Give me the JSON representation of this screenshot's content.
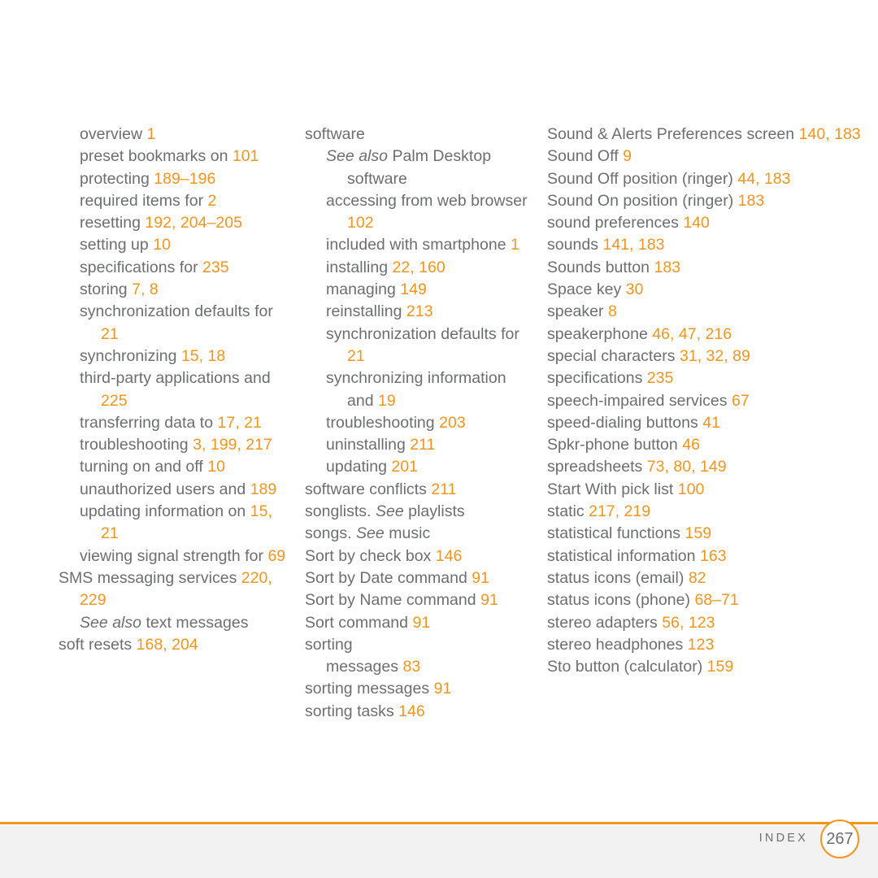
{
  "accent_color": "#f7941e",
  "text_color": "#6d6e70",
  "footer": {
    "label": "INDEX",
    "page_number": "267"
  },
  "columns": [
    {
      "id": "column-1",
      "entries": [
        {
          "level": 1,
          "text": "overview ",
          "pages": "1"
        },
        {
          "level": 1,
          "text": "preset bookmarks on ",
          "pages": "101"
        },
        {
          "level": 1,
          "text": "protecting ",
          "pages": "189–196"
        },
        {
          "level": 1,
          "text": "required items for ",
          "pages": "2"
        },
        {
          "level": 1,
          "text": "resetting ",
          "pages": "192, 204–205"
        },
        {
          "level": 1,
          "text": "setting up ",
          "pages": "10"
        },
        {
          "level": 1,
          "text": "specifications for ",
          "pages": "235"
        },
        {
          "level": 1,
          "text": "storing ",
          "pages": "7, 8"
        },
        {
          "level": 1,
          "text": "synchronization defaults for ",
          "pages": "21"
        },
        {
          "level": 1,
          "text": "synchronizing ",
          "pages": "15, 18"
        },
        {
          "level": 1,
          "text": "third-party applications and ",
          "pages": "225"
        },
        {
          "level": 1,
          "text": "transferring data to ",
          "pages": "17, 21"
        },
        {
          "level": 1,
          "text": "troubleshooting ",
          "pages": "3, 199, 217"
        },
        {
          "level": 1,
          "text": "turning on and off ",
          "pages": "10"
        },
        {
          "level": 1,
          "text": "unauthorized users and ",
          "pages": "189"
        },
        {
          "level": 1,
          "text": "updating information on ",
          "pages": "15, 21"
        },
        {
          "level": 1,
          "text": "viewing signal strength for ",
          "pages": "69"
        },
        {
          "level": 0,
          "text": "SMS messaging services ",
          "pages": "220, 229"
        },
        {
          "level": 1,
          "see_also": "See also",
          "text": " text messages",
          "pages": ""
        },
        {
          "level": 0,
          "text": "soft resets ",
          "pages": "168, 204"
        }
      ]
    },
    {
      "id": "column-2",
      "entries": [
        {
          "level": 0,
          "text": "software",
          "pages": ""
        },
        {
          "level": 1,
          "see_also": "See also",
          "text": " Palm Desktop software",
          "pages": ""
        },
        {
          "level": 1,
          "text": "accessing from web browser ",
          "pages": "102"
        },
        {
          "level": 1,
          "text": "included with smartphone ",
          "pages": "1"
        },
        {
          "level": 1,
          "text": "installing ",
          "pages": "22, 160"
        },
        {
          "level": 1,
          "text": "managing ",
          "pages": "149"
        },
        {
          "level": 1,
          "text": "reinstalling ",
          "pages": "213"
        },
        {
          "level": 1,
          "text": "synchronization defaults for ",
          "pages": "21"
        },
        {
          "level": 1,
          "text": "synchronizing information and ",
          "pages": "19"
        },
        {
          "level": 1,
          "text": "troubleshooting ",
          "pages": "203"
        },
        {
          "level": 1,
          "text": "uninstalling ",
          "pages": "211"
        },
        {
          "level": 1,
          "text": "updating ",
          "pages": "201"
        },
        {
          "level": 0,
          "text": "software conflicts ",
          "pages": "211"
        },
        {
          "level": 0,
          "text": "songlists. ",
          "see_also_mid": "See",
          "text_after": " playlists",
          "pages": ""
        },
        {
          "level": 0,
          "text": "songs. ",
          "see_also_mid": "See",
          "text_after": " music",
          "pages": ""
        },
        {
          "level": 0,
          "text": "Sort by check box ",
          "pages": "146"
        },
        {
          "level": 0,
          "text": "Sort by Date command ",
          "pages": "91"
        },
        {
          "level": 0,
          "text": "Sort by Name command ",
          "pages": "91"
        },
        {
          "level": 0,
          "text": "Sort command ",
          "pages": "91"
        },
        {
          "level": 0,
          "text": "sorting",
          "pages": ""
        },
        {
          "level": 1,
          "text": "messages ",
          "pages": "83"
        },
        {
          "level": 0,
          "text": "sorting messages ",
          "pages": "91"
        },
        {
          "level": 0,
          "text": "sorting tasks ",
          "pages": "146"
        }
      ]
    },
    {
      "id": "column-3",
      "entries": [
        {
          "level": 0,
          "text": "Sound & Alerts Preferences screen ",
          "pages": "140, 183"
        },
        {
          "level": 0,
          "text": "Sound Off ",
          "pages": "9"
        },
        {
          "level": 0,
          "text": "Sound Off position (ringer) ",
          "pages": "44, 183"
        },
        {
          "level": 0,
          "text": "Sound On position (ringer) ",
          "pages": "183"
        },
        {
          "level": 0,
          "text": "sound preferences ",
          "pages": "140"
        },
        {
          "level": 0,
          "text": "sounds ",
          "pages": "141, 183"
        },
        {
          "level": 0,
          "text": "Sounds button ",
          "pages": "183"
        },
        {
          "level": 0,
          "text": "Space key ",
          "pages": "30"
        },
        {
          "level": 0,
          "text": "speaker ",
          "pages": "8"
        },
        {
          "level": 0,
          "text": "speakerphone ",
          "pages": "46, 47, 216"
        },
        {
          "level": 0,
          "text": "special characters ",
          "pages": "31, 32, 89"
        },
        {
          "level": 0,
          "text": "specifications ",
          "pages": "235"
        },
        {
          "level": 0,
          "text": "speech-impaired services ",
          "pages": "67"
        },
        {
          "level": 0,
          "text": "speed-dialing buttons ",
          "pages": "41"
        },
        {
          "level": 0,
          "text": "Spkr-phone button ",
          "pages": "46"
        },
        {
          "level": 0,
          "text": "spreadsheets ",
          "pages": "73, 80, 149"
        },
        {
          "level": 0,
          "text": "Start With pick list ",
          "pages": "100"
        },
        {
          "level": 0,
          "text": "static ",
          "pages": "217, 219"
        },
        {
          "level": 0,
          "text": "statistical functions ",
          "pages": "159"
        },
        {
          "level": 0,
          "text": "statistical information ",
          "pages": "163"
        },
        {
          "level": 0,
          "text": "status icons (email) ",
          "pages": "82"
        },
        {
          "level": 0,
          "text": "status icons (phone) ",
          "pages": "68–71"
        },
        {
          "level": 0,
          "text": "stereo adapters ",
          "pages": "56, 123"
        },
        {
          "level": 0,
          "text": "stereo headphones ",
          "pages": "123"
        },
        {
          "level": 0,
          "text": "Sto button (calculator) ",
          "pages": "159"
        }
      ]
    }
  ]
}
